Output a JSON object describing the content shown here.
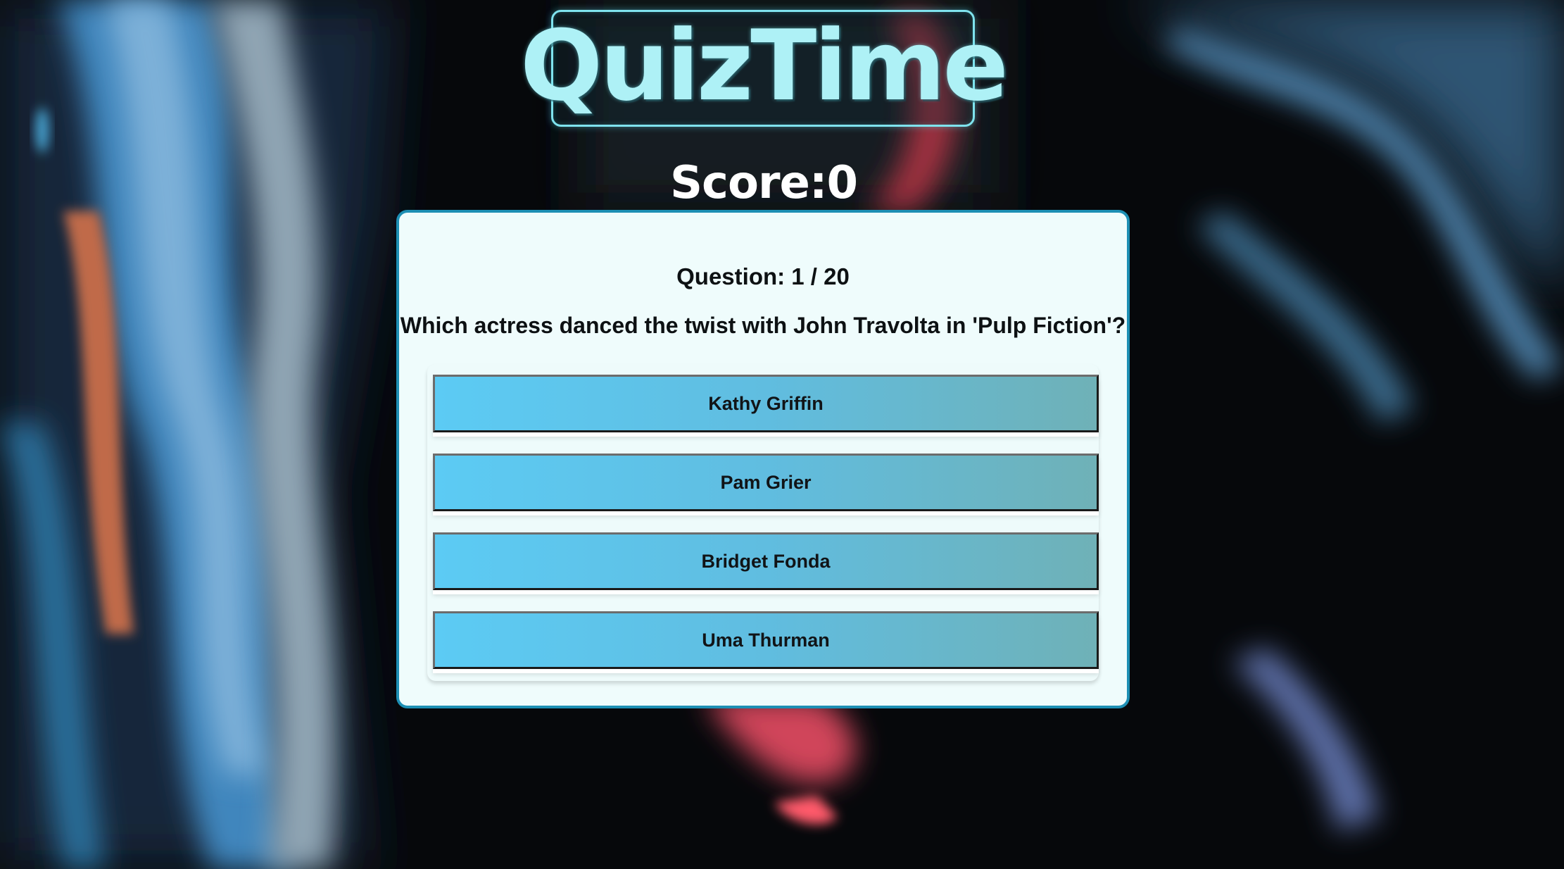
{
  "app": {
    "logo_text": "QuizTime"
  },
  "score": {
    "label": "Score:",
    "value": "0"
  },
  "question": {
    "counter": "Question: 1 / 20",
    "text": "Which actress danced the twist with John Travolta in 'Pulp Fiction'?"
  },
  "answers": [
    {
      "label": "Kathy Griffin"
    },
    {
      "label": "Pam Grier"
    },
    {
      "label": "Bridget Fonda"
    },
    {
      "label": "Uma Thurman"
    }
  ],
  "colors": {
    "card_border": "#1d8fb4",
    "card_background": "#effcfc",
    "answer_gradient_start": "#5ccbf4",
    "answer_gradient_end": "#6fb1b7",
    "logo": "#aef1f6"
  }
}
